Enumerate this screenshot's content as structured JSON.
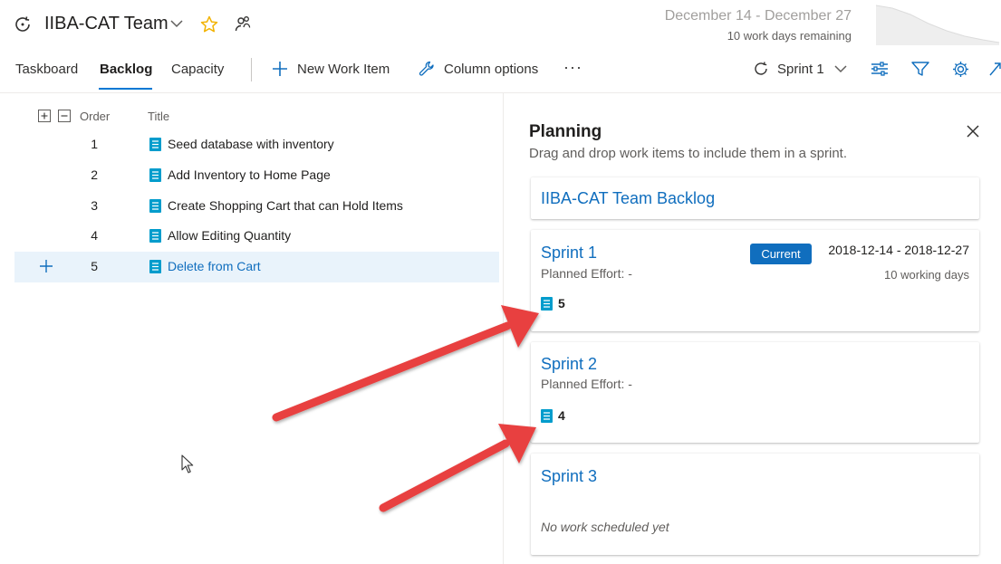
{
  "header": {
    "team_name": "IIBA-CAT Team",
    "date_range": "December 14 - December 27",
    "days_remaining": "10 work days remaining"
  },
  "tabs": [
    {
      "label": "Taskboard",
      "active": false
    },
    {
      "label": "Backlog",
      "active": true
    },
    {
      "label": "Capacity",
      "active": false
    }
  ],
  "toolbar": {
    "new_work_item": "New Work Item",
    "column_options": "Column options",
    "more": "···",
    "sprint_selector": "Sprint 1"
  },
  "backlog": {
    "columns": {
      "order": "Order",
      "title": "Title"
    },
    "rows": [
      {
        "order": "1",
        "title": "Seed database with inventory"
      },
      {
        "order": "2",
        "title": "Add Inventory to Home Page"
      },
      {
        "order": "3",
        "title": "Create Shopping Cart that can Hold Items"
      },
      {
        "order": "4",
        "title": "Allow Editing Quantity"
      },
      {
        "order": "5",
        "title": "Delete from Cart",
        "selected": true
      }
    ]
  },
  "planning": {
    "title": "Planning",
    "subtitle": "Drag and drop work items to include them in a sprint.",
    "team_backlog": "IIBA-CAT Team Backlog",
    "sprints": [
      {
        "name": "Sprint 1",
        "effort": "Planned Effort: -",
        "badge": "Current",
        "dates": "2018-12-14 - 2018-12-27",
        "working_days": "10 working days",
        "count": "5"
      },
      {
        "name": "Sprint 2",
        "effort": "Planned Effort: -",
        "count": "4"
      },
      {
        "name": "Sprint 3",
        "empty": "No work scheduled yet"
      }
    ]
  },
  "colors": {
    "accent": "#0078d4",
    "link": "#106ebe",
    "star": "#f2b200",
    "work_item_icon": "#009ccc",
    "annotation_arrow": "#e8413f"
  },
  "icons": [
    "sprint-cycle-icon",
    "chevron-down-icon",
    "star-icon",
    "team-members-icon",
    "plus-icon",
    "wrench-icon",
    "filter-settings-icon",
    "filter-icon",
    "gear-icon",
    "expand-icon",
    "collapse-icon",
    "work-item-icon",
    "close-icon",
    "mouse-cursor-icon"
  ]
}
